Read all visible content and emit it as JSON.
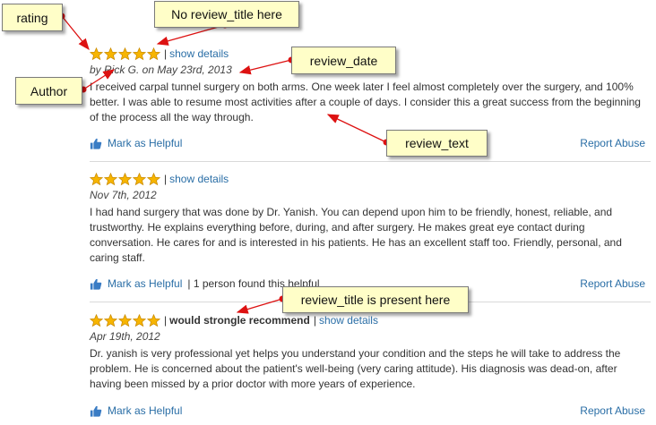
{
  "reviews": [
    {
      "title": "",
      "show_details": "show details",
      "author_date": "by Rick G. on May 23rd, 2013",
      "text": "I received carpal tunnel surgery on both arms. One week later I feel almost completely over the surgery, and 100% better. I was able to resume most activities after a couple of days. I consider this a great success from the beginning of the process all the way through.",
      "helpful_label": "Mark as Helpful",
      "found_helpful": "",
      "report_label": "Report Abuse",
      "rating": 5
    },
    {
      "title": "",
      "show_details": "show details",
      "author_date": "Nov 7th, 2012",
      "text": "I had hand surgery that was done by Dr. Yanish. You can depend upon him to be friendly, honest, reliable, and trustworthy. He explains everything before, during, and after surgery. He makes great eye contact during conversation. He cares for and is interested in his patients. He has an excellent staff too. Friendly, personal, and caring staff.",
      "helpful_label": "Mark as Helpful",
      "found_helpful": "| 1 person found this helpful",
      "report_label": "Report Abuse",
      "rating": 5
    },
    {
      "title": "would strongle recommend",
      "show_details": "show details",
      "author_date": "Apr 19th, 2012",
      "text": "Dr. yanish is very professional yet helps you understand your condition and the steps he will take to address the problem. He is concerned about the patient's well-being (very caring attitude). His diagnosis was dead-on, after having been missed by a prior doctor with more years of experience.",
      "helpful_label": "Mark as Helpful",
      "found_helpful": "",
      "report_label": "Report Abuse",
      "rating": 5
    }
  ],
  "annotations": {
    "rating": "rating",
    "no_title": "No review_title here",
    "review_date": "review_date",
    "author": "Author",
    "review_text": "review_text",
    "title_present": "review_title is present here"
  },
  "colors": {
    "link": "#2a6ea6",
    "star": "#f5b400",
    "callout_bg": "#fffec8",
    "arrow": "#dd1111"
  },
  "icons": {
    "star": "star-icon",
    "thumb": "thumbs-up-icon"
  }
}
